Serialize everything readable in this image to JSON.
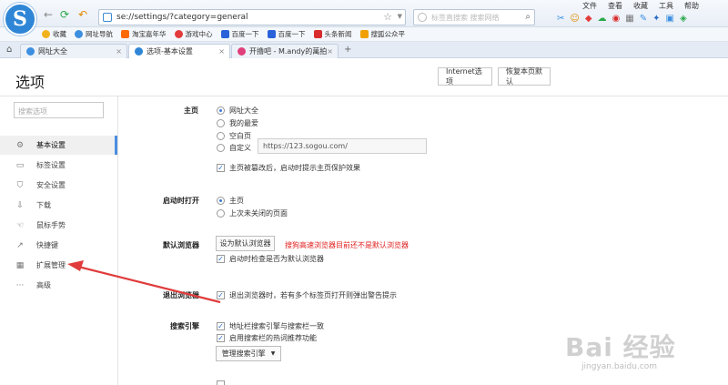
{
  "browser": {
    "url": "se://settings/?category=general",
    "search_placeholder": "标签直搜索 搜索网络",
    "menus": [
      "文件",
      "查看",
      "收藏",
      "工具",
      "帮助"
    ],
    "favorites": [
      {
        "label": "收藏",
        "color": "#f2b21a"
      },
      {
        "label": "网址导航",
        "color": "#3d8fe0"
      },
      {
        "label": "淘宝嘉年华",
        "color": "#ff6a00"
      },
      {
        "label": "游戏中心",
        "color": "#e33c3c"
      },
      {
        "label": "百度一下",
        "color": "#2b62d9"
      },
      {
        "label": "百度一下",
        "color": "#2b62d9"
      },
      {
        "label": "头条新闻",
        "color": "#d92b2b"
      },
      {
        "label": "搜狐公众平",
        "color": "#f0a000"
      }
    ],
    "tabs": [
      {
        "label": "网址大全",
        "color": "#3d8fe0"
      },
      {
        "label": "选项-基本设置",
        "color": "#2f86d6"
      },
      {
        "label": "开撸吧 - M.andy的萬拍",
        "color": "#e0407a"
      }
    ]
  },
  "page": {
    "title": "选项",
    "internet_options": "Internet选项",
    "restore_defaults": "恢复本页默认",
    "sidebar_search_placeholder": "搜索选项",
    "sidebar": [
      {
        "label": "基本设置",
        "icon": "gear-icon",
        "glyph": "⚙"
      },
      {
        "label": "标签设置",
        "icon": "tab-icon",
        "glyph": "▭"
      },
      {
        "label": "安全设置",
        "icon": "shield-icon",
        "glyph": "⛉"
      },
      {
        "label": "下载",
        "icon": "download-icon",
        "glyph": "⇩"
      },
      {
        "label": "鼠标手势",
        "icon": "mouse-gesture-icon",
        "glyph": "☜"
      },
      {
        "label": "快捷键",
        "icon": "shortcut-icon",
        "glyph": "↗"
      },
      {
        "label": "扩展管理",
        "icon": "extensions-icon",
        "glyph": "▦"
      },
      {
        "label": "高级",
        "icon": "more-icon",
        "glyph": "···"
      }
    ]
  },
  "settings": {
    "homepage": {
      "title": "主页",
      "options": [
        "网址大全",
        "我的最爱",
        "空白页",
        "自定义"
      ],
      "selected": 0,
      "custom_url": "https://123.sogou.com/",
      "protect_label": "主页被篡改后，启动时提示主页保护效果"
    },
    "startup": {
      "title": "启动时打开",
      "options": [
        "主页",
        "上次未关闭的页面"
      ],
      "selected": 0
    },
    "default_browser": {
      "title": "默认浏览器",
      "button": "设为默认浏览器",
      "warning": "搜狗高速浏览器目前还不是默认浏览器",
      "check_label": "启动时检查是否为默认浏览器"
    },
    "exit": {
      "title": "退出浏览器",
      "check_label": "退出浏览器时，若有多个标签页打开则弹出警告提示"
    },
    "search_engine": {
      "title": "搜索引擎",
      "check1": "地址栏搜索引擎与搜索栏一致",
      "check2": "启用搜索栏的热词推荐功能",
      "manage_button": "管理搜索引擎"
    }
  },
  "watermark": {
    "main": "Bai 经验",
    "sub": "jingyan.baidu.com"
  },
  "colors": {
    "accent": "#4b8ee0",
    "warning": "#e02020",
    "annotation_arrow": "#e03c3c"
  }
}
